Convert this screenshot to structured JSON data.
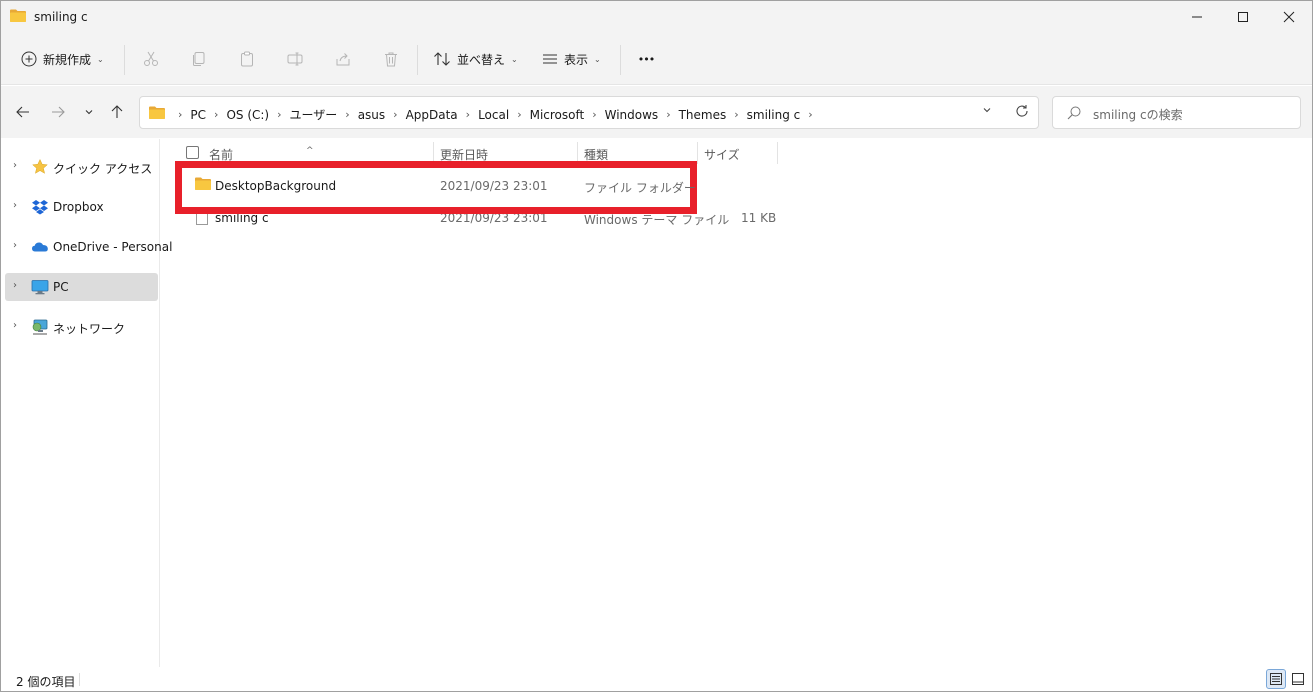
{
  "window": {
    "title": "smiling c",
    "accent_color": "#f8c740",
    "highlight_color": "#e8202a"
  },
  "toolbar": {
    "new_label": "新規作成",
    "sort_label": "並べ替え",
    "view_label": "表示",
    "more_label": "•••"
  },
  "address": {
    "crumbs": [
      "PC",
      "OS (C:)",
      "ユーザー",
      "asus",
      "AppData",
      "Local",
      "Microsoft",
      "Windows",
      "Themes",
      "smiling c"
    ]
  },
  "search": {
    "placeholder": "smiling cの検索"
  },
  "sidebar": {
    "items": [
      {
        "label": "クイック アクセス",
        "icon": "star-icon"
      },
      {
        "label": "Dropbox",
        "icon": "dropbox-icon"
      },
      {
        "label": "OneDrive - Personal",
        "icon": "cloud-icon"
      },
      {
        "label": "PC",
        "icon": "monitor-icon",
        "selected": true
      },
      {
        "label": "ネットワーク",
        "icon": "network-icon"
      }
    ]
  },
  "columns": {
    "name": "名前",
    "date": "更新日時",
    "type": "種類",
    "size": "サイズ"
  },
  "files": [
    {
      "name": "DesktopBackground",
      "date": "2021/09/23 23:01",
      "type": "ファイル フォルダー",
      "size": "",
      "icon": "folder-icon"
    },
    {
      "name": "smiling c",
      "date": "2021/09/23 23:01",
      "type": "Windows テーマ ファイル",
      "size": "11 KB",
      "icon": "file-icon"
    }
  ],
  "status": {
    "item_count": "2 個の項目"
  }
}
